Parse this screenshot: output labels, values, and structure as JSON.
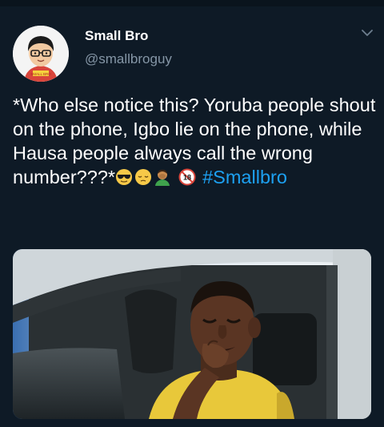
{
  "tweet": {
    "display_name": "Small Bro",
    "handle": "@smallbroguy",
    "avatar_badge_text": "SMALL BRO",
    "text_main": "*Who else notice this? Yoruba people shout on the phone, Igbo lie on the phone, while Hausa people always call the wrong number???*",
    "hashtag": "#Smallbro",
    "emojis": [
      "sunglasses-emoji",
      "pensive-face-emoji",
      "man-facepalming-emoji",
      "no-one-under-18-emoji"
    ],
    "emoji_18_text": "18",
    "media_description_icon": "photo-of-man-crying-in-car"
  },
  "colors": {
    "background": "#0e1a26",
    "text": "#ffffff",
    "secondary_text": "#8596a6",
    "link": "#1da1f2"
  }
}
